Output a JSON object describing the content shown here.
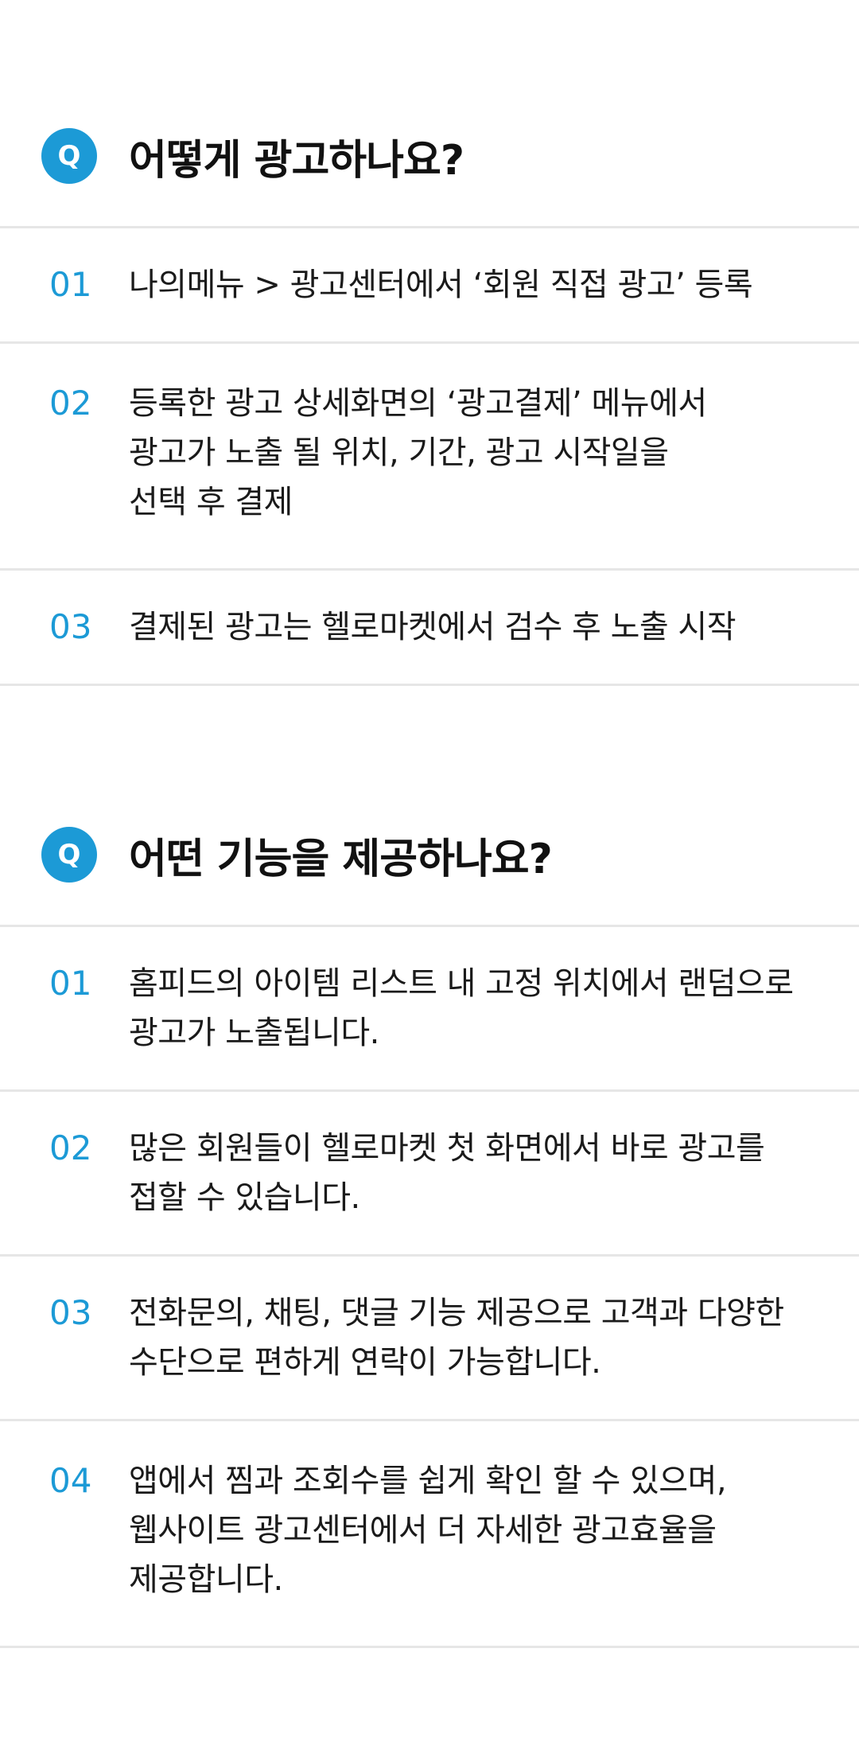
{
  "sections": [
    {
      "badge": "Q",
      "title": "어떻게 광고하나요?",
      "items": [
        {
          "num": "01",
          "text": "나의메뉴 > 광고센터에서 ‘회원 직접 광고’ 등록"
        },
        {
          "num": "02",
          "text": "등록한 광고 상세화면의 ‘광고결제’ 메뉴에서\n광고가 노출 될 위치, 기간, 광고 시작일을\n선택 후 결제"
        },
        {
          "num": "03",
          "text": "결제된 광고는 헬로마켓에서 검수 후 노출 시작"
        }
      ]
    },
    {
      "badge": "Q",
      "title": "어떤 기능을 제공하나요?",
      "items": [
        {
          "num": "01",
          "text": "홈피드의 아이템 리스트 내 고정 위치에서 랜덤으로\n광고가 노출됩니다."
        },
        {
          "num": "02",
          "text": "많은 회원들이 헬로마켓 첫 화면에서 바로 광고를\n접할 수 있습니다."
        },
        {
          "num": "03",
          "text": "전화문의, 채팅, 댓글 기능 제공으로 고객과 다양한\n수단으로 편하게 연락이 가능합니다."
        },
        {
          "num": "04",
          "text": "앱에서 찜과 조회수를 쉽게 확인 할 수 있으며,\n웹사이트 광고센터에서 더 자세한 광고효율을\n제공합니다."
        }
      ]
    }
  ],
  "colors": {
    "accent": "#1c9ad6",
    "divider": "#e6e6e6",
    "text": "#1a1a1a"
  }
}
